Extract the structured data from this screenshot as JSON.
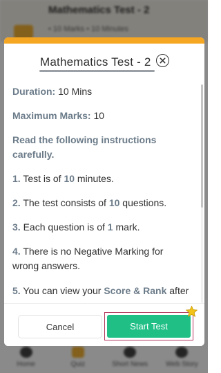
{
  "background": {
    "title": "Mathematics Test - 2",
    "meta": "• 10 Marks  • 10 Minutes",
    "nav": [
      {
        "label": "Home",
        "icon": "home-icon"
      },
      {
        "label": "Quiz",
        "icon": "quiz-icon"
      },
      {
        "label": "Short News",
        "icon": "news-icon"
      },
      {
        "label": "Web Story",
        "icon": "web-story-icon"
      }
    ]
  },
  "modal": {
    "title": "Mathematics Test - 2",
    "close_icon": "close-circle-icon",
    "duration_label": "Duration:",
    "duration_value": "10 Mins",
    "marks_label": "Maximum Marks:",
    "marks_value": "10",
    "instructions_heading": "Read the following instructions carefully.",
    "instructions": [
      {
        "num": "1.",
        "pre": "Test is of ",
        "hl": "10",
        "post": " minutes."
      },
      {
        "num": "2.",
        "pre": "The test consists of ",
        "hl": "10",
        "post": " questions."
      },
      {
        "num": "3.",
        "pre": "Each question is of ",
        "hl": "1",
        "post": " mark."
      },
      {
        "num": "4.",
        "pre": "There is no Negative Marking for wrong answers.",
        "hl": "",
        "post": ""
      },
      {
        "num": "5.",
        "pre": "You can view your ",
        "hl": "Score & Rank",
        "post": " after"
      }
    ],
    "cancel_label": "Cancel",
    "start_label": "Start Test",
    "star_icon": "star-icon"
  },
  "colors": {
    "accent_orange": "#f5a623",
    "start_green": "#1fbf86",
    "label_slate": "#6b7b89",
    "star_gold": "#f2c318"
  }
}
